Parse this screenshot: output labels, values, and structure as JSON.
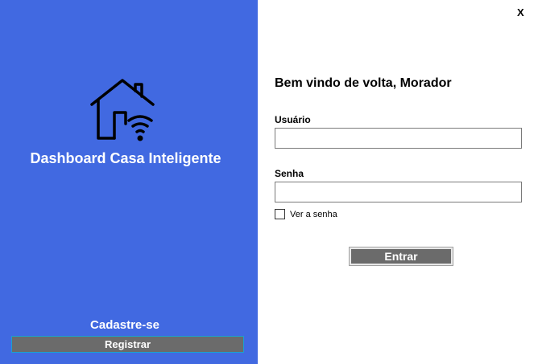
{
  "sidebar": {
    "logo_icon": "smart-home-wifi-icon",
    "app_title": "Dashboard Casa Inteligente",
    "signup_label": "Cadastre-se",
    "register_button": "Registrar",
    "background_color": "#4169e1"
  },
  "window": {
    "close_label": "X"
  },
  "login": {
    "welcome": "Bem vindo de volta, Morador",
    "username_label": "Usuário",
    "username_value": "",
    "password_label": "Senha",
    "password_value": "",
    "show_password_label": "Ver a senha",
    "show_password_checked": false,
    "enter_button": "Entrar"
  }
}
